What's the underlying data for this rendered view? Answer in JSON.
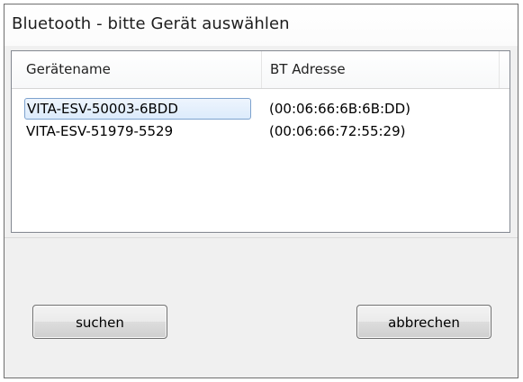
{
  "window": {
    "title": "Bluetooth - bitte Gerät auswählen"
  },
  "list": {
    "columns": [
      "Gerätename",
      "BT Adresse"
    ],
    "rows": [
      {
        "name": "VITA-ESV-50003-6BDD",
        "address": "(00:06:66:6B:6B:DD)",
        "selected": true
      },
      {
        "name": "VITA-ESV-51979-5529",
        "address": "(00:06:66:72:55:29)",
        "selected": false
      }
    ]
  },
  "buttons": {
    "search_label": "suchen",
    "cancel_label": "abbrechen"
  },
  "colors": {
    "selection_border": "#7da2ce",
    "selection_fill": "#dcebfc",
    "dialog_background": "#f0f0f0"
  }
}
